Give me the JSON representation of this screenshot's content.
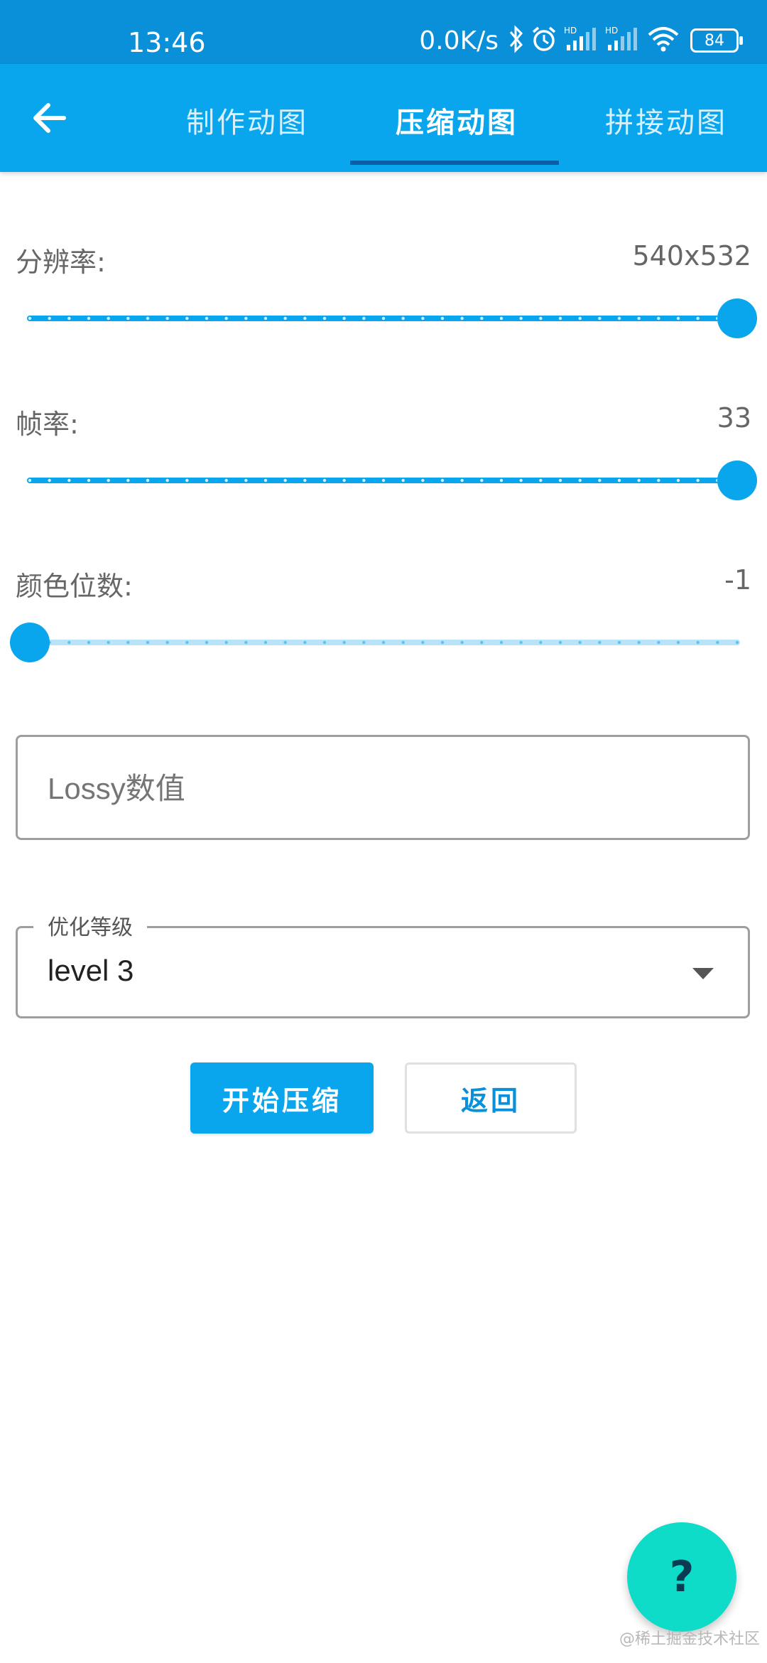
{
  "status_bar": {
    "time": "13:46",
    "net_speed": "0.0K/s",
    "battery": "84",
    "icons": [
      "bluetooth-icon",
      "alarm-icon",
      "hd-signal-icon",
      "hd-signal-icon",
      "wifi-icon",
      "battery-icon"
    ]
  },
  "app_bar": {
    "back_icon": "arrow-left-icon",
    "tabs": [
      {
        "label": "制作动图",
        "selected": false
      },
      {
        "label": "压缩动图",
        "selected": true
      },
      {
        "label": "拼接动图",
        "selected": false
      }
    ],
    "background": "#09a6ee",
    "indicator_color": "#0a5ea6"
  },
  "settings": {
    "resolution": {
      "label": "分辨率:",
      "value": "540x532",
      "slider_fraction": 1.0
    },
    "fps": {
      "label": "帧率:",
      "value": "33",
      "slider_fraction": 1.0
    },
    "color_bits": {
      "label": "颜色位数:",
      "value": "-1",
      "slider_fraction": 0.0
    }
  },
  "lossy": {
    "placeholder": "Lossy数值",
    "value": ""
  },
  "optimize": {
    "legend": "优化等级",
    "value": "level 3",
    "arrow_icon": "dropdown-arrow-icon"
  },
  "actions": {
    "start_label": "开始压缩",
    "back_label": "返回"
  },
  "fab": {
    "glyph": "?",
    "icon": "help-icon",
    "color": "#0fdcc8"
  },
  "watermark": "@稀土掘金技术社区",
  "accent_color": "#09a6ee"
}
